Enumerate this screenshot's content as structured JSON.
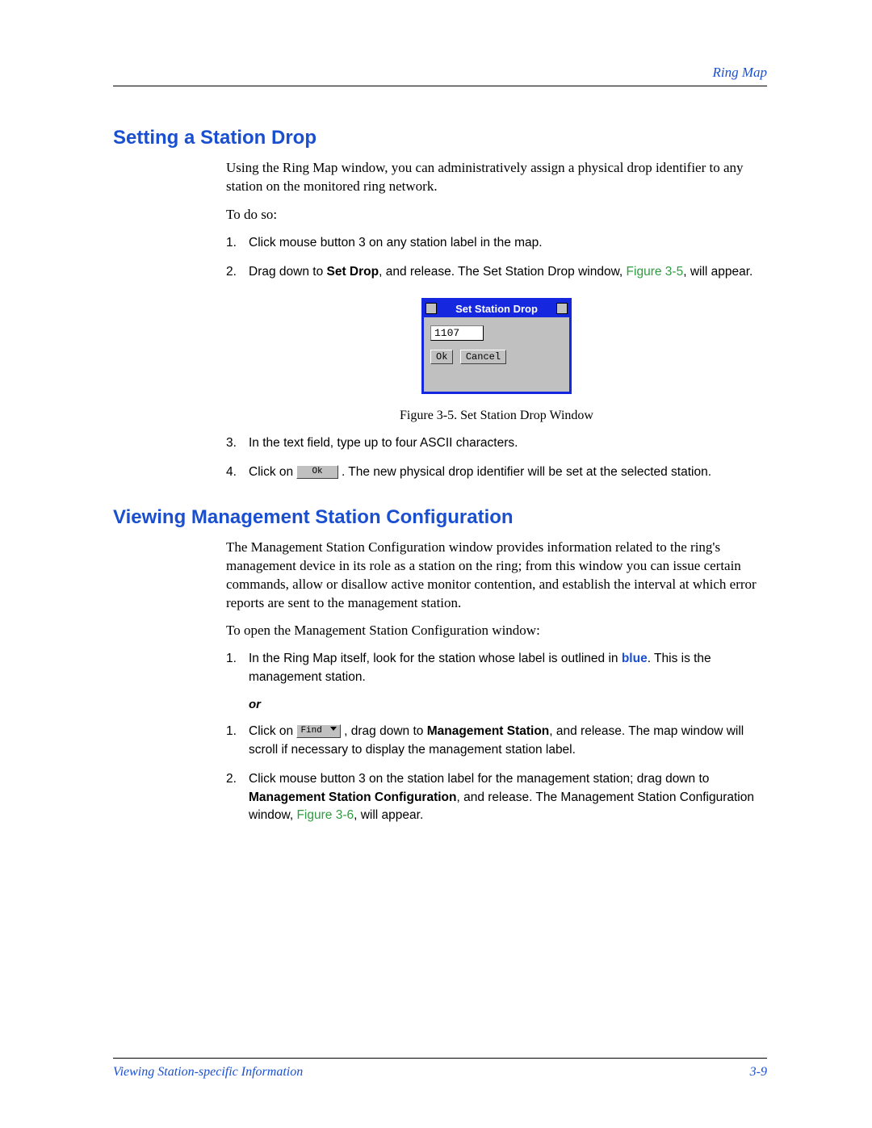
{
  "header": {
    "right": "Ring Map"
  },
  "section1": {
    "title": "Setting a Station Drop",
    "intro": "Using the Ring Map window, you can administratively assign a physical drop identifier to any station on the monitored ring network.",
    "todo": "To do so:",
    "step1": "Click mouse button 3 on any station label in the map.",
    "step2_a": "Drag down to ",
    "step2_bold": "Set Drop",
    "step2_b": ", and release. The Set Station Drop window, ",
    "step2_link": "Figure 3-5",
    "step2_c": ", will appear.",
    "step3": "In the text field, type up to four ASCII characters.",
    "step4_a": "Click on ",
    "step4_btn": "Ok",
    "step4_b": ". The new physical drop identifier will be set at the selected station."
  },
  "figure": {
    "title": "Set Station Drop",
    "input_value": "1107",
    "ok": "Ok",
    "cancel": "Cancel",
    "caption": "Figure 3-5.  Set Station Drop Window"
  },
  "section2": {
    "title": "Viewing Management Station Configuration",
    "intro": "The Management Station Configuration window provides information related to the ring's management device in its role as a station on the ring; from this window you can issue certain commands, allow or disallow active monitor contention, and establish the interval at which error reports are sent to the management station.",
    "open": "To open the Management Station Configuration window:",
    "s1_a": "In the Ring Map itself, look for the station whose label is outlined in ",
    "s1_blue": "blue",
    "s1_b": ". This is the management station.",
    "or": "or",
    "s1b_a": "Click on ",
    "s1b_find": "Find",
    "s1b_b": ", drag down to ",
    "s1b_bold": "Management Station",
    "s1b_c": ", and release. The map window will scroll if necessary to display the management station label.",
    "s2_a": "Click mouse button 3 on the station label for the management station; drag down to ",
    "s2_bold": "Management Station Configuration",
    "s2_b": ", and release. The Management Station Configuration window, ",
    "s2_link": "Figure 3-6",
    "s2_c": ", will appear."
  },
  "footer": {
    "left": "Viewing Station-specific Information",
    "right": "3-9"
  }
}
